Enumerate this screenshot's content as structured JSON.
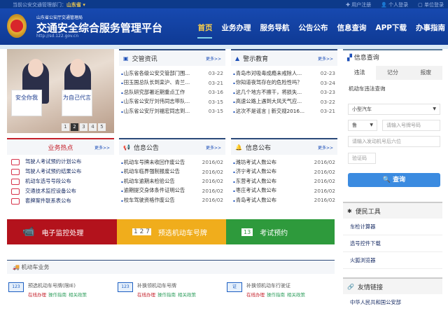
{
  "topbar": {
    "current_label": "当前公安交通管理部门：",
    "current_region": "山东省 ▾",
    "register": "✚ 用户注册",
    "personal_login": "👤 个人登录",
    "unit_login": "▢ 单位登录"
  },
  "header": {
    "subtitle": "山东省公安厅交通管理局",
    "title": "交通安全综合服务管理平台",
    "url": "http://sd.122.gov.cn",
    "nav": [
      "首页",
      "业务办理",
      "服务导航",
      "公告公布",
      "信息查询",
      "APP下载",
      "办事指南"
    ]
  },
  "carousel": {
    "signs": [
      "安全你我",
      "为自己代言"
    ],
    "pages": [
      "1",
      "2",
      "3",
      "4",
      "5"
    ],
    "active": 2
  },
  "news": {
    "title": "交管资讯",
    "more": "更多>>",
    "items": [
      {
        "t": "山东省各级公安交管部门围...",
        "d": "03-22"
      },
      {
        "t": "田玉国总队长到栾沪、青兰...",
        "d": "03-21"
      },
      {
        "t": "总队研究部署近期重点工作",
        "d": "03-16"
      },
      {
        "t": "山东省公安厅刘伟同志带队...",
        "d": "03-15"
      },
      {
        "t": "山东省公安厅刘福宏同志到...",
        "d": "03-15"
      }
    ]
  },
  "warning": {
    "title": "警示教育",
    "more": "更多>>",
    "items": [
      {
        "t": "青岛市对吸毒成瘾未戒除人...",
        "d": "02-23"
      },
      {
        "t": "你知道夜驾存在的危险性吗？",
        "d": "03-24"
      },
      {
        "t": "这几个地方不擦干，将损失...",
        "d": "03-23"
      },
      {
        "t": "高速公路上遇到大风天气应...",
        "d": "03-22"
      },
      {
        "t": "这次不是谣言 | 新交规2016...",
        "d": "03-21"
      }
    ]
  },
  "hot": {
    "title": "业务热点",
    "more": "更多>>",
    "items": [
      "驾驶人考试预约计划公布",
      "驾驶人考试预约结果公布",
      "机动车选号号段公布",
      "交通技术监控设备公布",
      "套牌案件联系表公布"
    ]
  },
  "notice": {
    "title": "信息公告",
    "more": "更多>>",
    "items": [
      {
        "t": "机动车号牌未收回作废公告",
        "d": "2016/02"
      },
      {
        "t": "机动车临界强制报废公告",
        "d": "2016/02"
      },
      {
        "t": "机动车逾期未检验公告",
        "d": "2016/02"
      },
      {
        "t": "逾期提交身体条件证明公告",
        "d": "2016/02"
      },
      {
        "t": "校车驾驶资格作废公告",
        "d": "2016/02"
      }
    ]
  },
  "publish": {
    "title": "信息公布",
    "more": "更多>>",
    "items": [
      {
        "t": "潍坊考试人数公布",
        "d": "2016/02"
      },
      {
        "t": "济宁考试人数公布",
        "d": "2016/02"
      },
      {
        "t": "东营考试人数公布",
        "d": "2016/02"
      },
      {
        "t": "枣庄考试人数公布",
        "d": "2016/02"
      },
      {
        "t": "青岛考试人数公布",
        "d": "2016/02"
      }
    ]
  },
  "banners": [
    {
      "label": "电子监控处理",
      "color": "#b3121c"
    },
    {
      "label": "预选机动车号牌",
      "color": "#f0ad1c"
    },
    {
      "label": "考试预约",
      "color": "#2e9a3c"
    }
  ],
  "vehicle": {
    "title": "机动车业务",
    "items": [
      {
        "name": "预选机动车号牌(限IE)",
        "icon": "123"
      },
      {
        "name": "补换领机动车号牌",
        "icon": "123"
      },
      {
        "name": "补换领机动车行驶证",
        "icon": "证"
      }
    ],
    "links": [
      "在线办理",
      "操作指南",
      "相关政策"
    ]
  },
  "query": {
    "title": "信息查询",
    "tabs": [
      "违法",
      "记分",
      "报废"
    ],
    "subtitle": "机动车违法查询",
    "vehicle_type": "小型汽车",
    "province": "鲁",
    "plate_placeholder": "请输入号牌号码",
    "engine_placeholder": "请输入发动机号后六位",
    "captcha_placeholder": "验证码",
    "button": "查询"
  },
  "tools": {
    "title": "便民工具",
    "items": [
      "车检计算器",
      "选号控件下载",
      "火狐浏览器"
    ]
  },
  "links": {
    "title": "友情链接",
    "items": [
      "中华人民共和国公安部"
    ]
  }
}
